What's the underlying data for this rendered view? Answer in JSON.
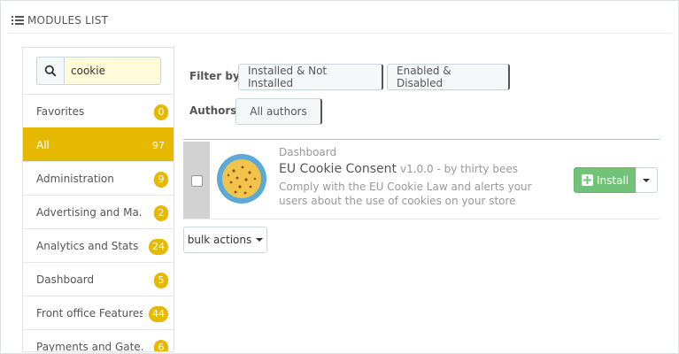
{
  "panel": {
    "title": "MODULES LIST"
  },
  "search": {
    "value": "cookie",
    "placeholder": ""
  },
  "categories": [
    {
      "label": "Favorites",
      "count": "0"
    },
    {
      "label": "All",
      "count": "97",
      "active": true
    },
    {
      "label": "Administration",
      "count": "9"
    },
    {
      "label": "Advertising and Ma...",
      "count": "2"
    },
    {
      "label": "Analytics and Stats",
      "count": "24"
    },
    {
      "label": "Dashboard",
      "count": "5"
    },
    {
      "label": "Front office Features",
      "count": "44"
    },
    {
      "label": "Payments and Gate...",
      "count": "6"
    }
  ],
  "filters": {
    "filter_by_label": "Filter by",
    "install_filter": "Installed & Not Installed",
    "status_filter": "Enabled & Disabled",
    "authors_label": "Authors",
    "authors_filter": "All authors"
  },
  "module": {
    "category": "Dashboard",
    "name": "EU Cookie Consent",
    "version": "v1.0.0 - by thirty bees",
    "description": "Comply with the EU Cookie Law and alerts your users about the use of cookies on your store",
    "install_label": "Install"
  },
  "bulk_actions": {
    "label": "bulk actions"
  },
  "colors": {
    "accent": "#e6b800",
    "install_green": "#72c279",
    "logo_ring": "#5aa9d6",
    "logo_fill": "#f2c34a"
  },
  "icons": [
    "list-icon",
    "search-icon",
    "cookie-logo-icon",
    "plus-icon",
    "caret-down-icon"
  ]
}
